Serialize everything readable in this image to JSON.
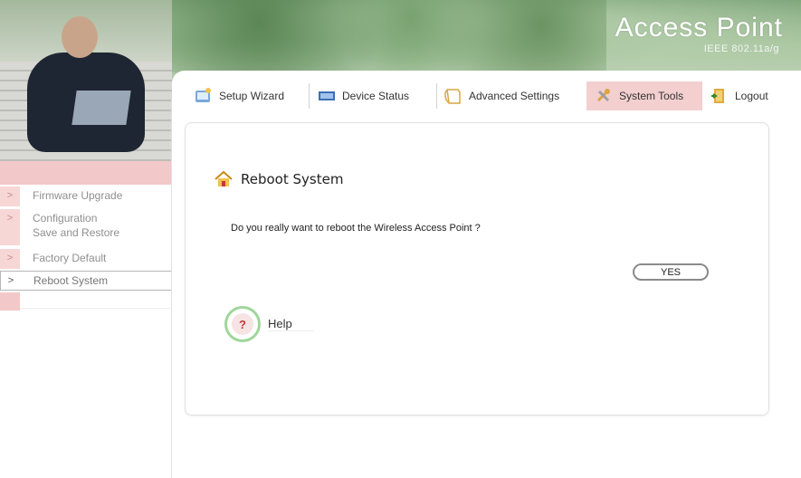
{
  "header": {
    "title": "Access Point",
    "subtitle": "IEEE 802.11a/g"
  },
  "tabs": [
    {
      "label": "Setup Wizard",
      "icon": "wizard-icon",
      "active": false
    },
    {
      "label": "Device Status",
      "icon": "monitor-icon",
      "active": false
    },
    {
      "label": "Advanced Settings",
      "icon": "document-icon",
      "active": false
    },
    {
      "label": "System Tools",
      "icon": "tools-icon",
      "active": true
    },
    {
      "label": "Logout",
      "icon": "door-icon",
      "active": false
    }
  ],
  "sidebar": {
    "items": [
      {
        "label": "Firmware Upgrade",
        "marker": ">"
      },
      {
        "label": "Configuration\nSave and Restore",
        "marker": ">"
      },
      {
        "label": "Factory Default",
        "marker": ">"
      },
      {
        "label": "Reboot System",
        "marker": ">",
        "active": true
      }
    ]
  },
  "main": {
    "title": "Reboot System",
    "title_icon": "home-icon",
    "question": "Do you really want to reboot the Wireless Access Point ?",
    "yes_label": "YES",
    "help_label": "Help",
    "help_icon": "help-icon"
  },
  "colors": {
    "accent_pink": "#f3cfcf",
    "help_ring": "#9fd69a"
  }
}
